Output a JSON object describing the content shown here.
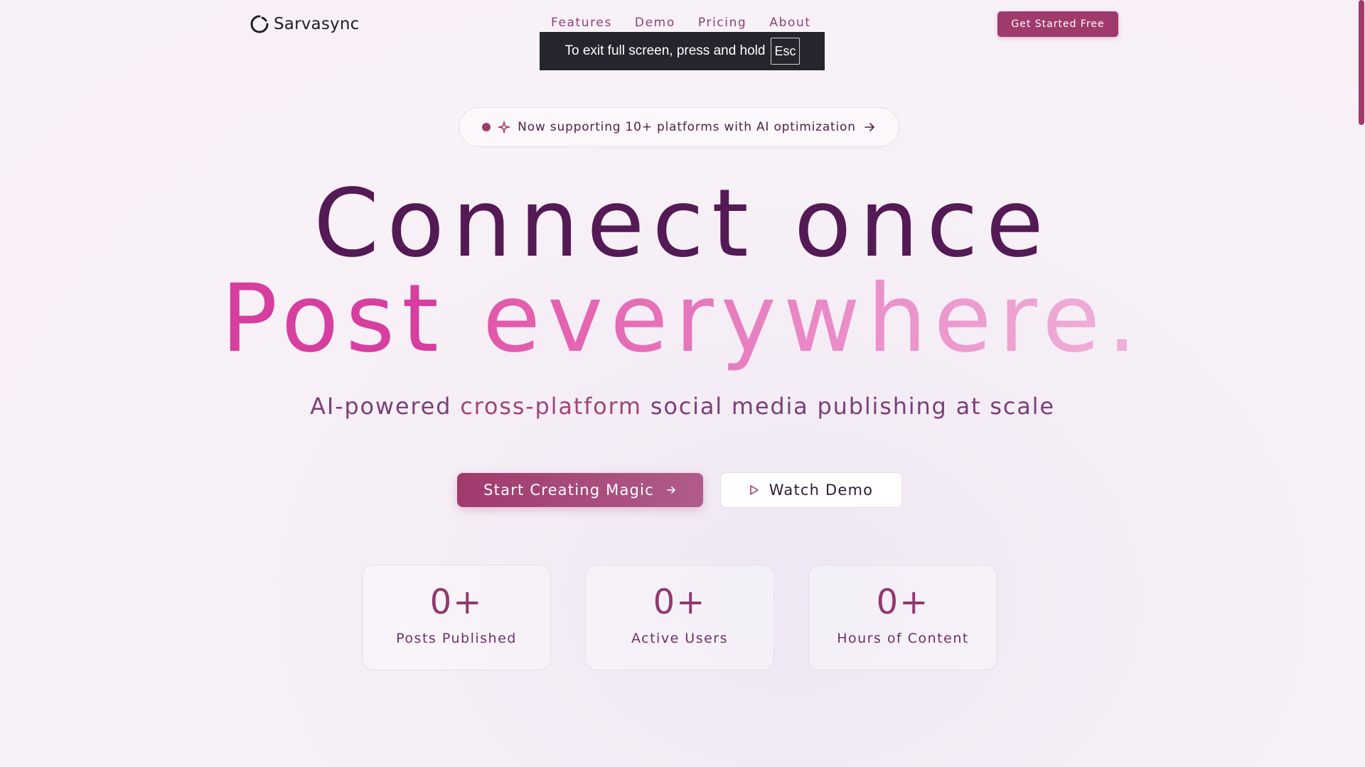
{
  "header": {
    "brand": "Sarvasync",
    "nav": [
      "Features",
      "Demo",
      "Pricing",
      "About"
    ],
    "cta": "Get Started Free"
  },
  "fullscreen_notice": {
    "text": "To exit full screen, press and hold",
    "key": "Esc"
  },
  "hero": {
    "announcement": "Now supporting 10+ platforms with AI optimization",
    "headline_line1": "Connect once",
    "headline_line2_part1": "Post",
    "headline_line2_part2": "everywhere.",
    "subtitle_part1": "AI-powered",
    "subtitle_highlight": "cross-platform",
    "subtitle_part2": "social media publishing at scale",
    "primary_button": "Start Creating Magic",
    "secondary_button": "Watch Demo"
  },
  "stats": [
    {
      "value": "0+",
      "label": "Posts Published"
    },
    {
      "value": "0+",
      "label": "Active Users"
    },
    {
      "value": "0+",
      "label": "Hours of Content"
    }
  ],
  "colors": {
    "brand": "#a03a6c",
    "headline": "#531a55",
    "accent_pink": "#d63ea0"
  },
  "icons": [
    "logo-icon",
    "sparkle-icon",
    "arrow-right-icon",
    "play-icon"
  ]
}
